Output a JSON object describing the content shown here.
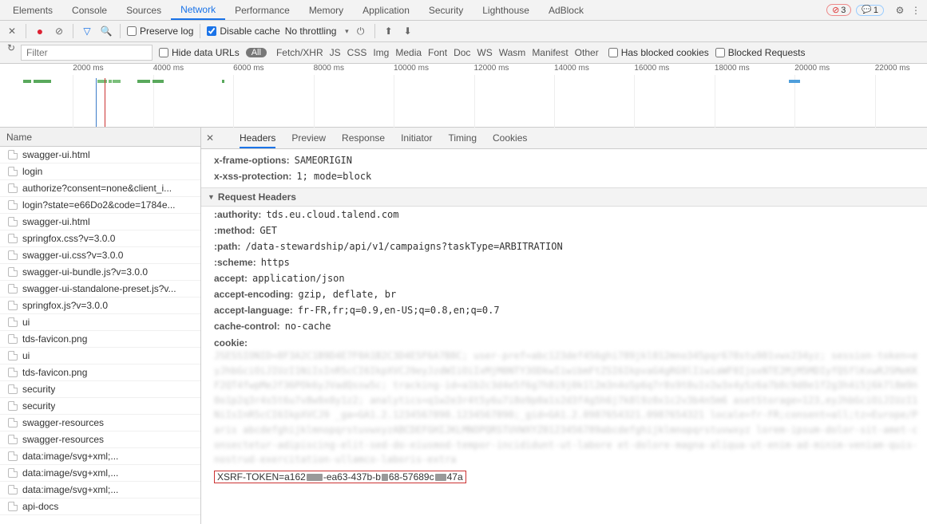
{
  "tabs": {
    "elements": "Elements",
    "console": "Console",
    "sources": "Sources",
    "network": "Network",
    "performance": "Performance",
    "memory": "Memory",
    "application": "Application",
    "security": "Security",
    "lighthouse": "Lighthouse",
    "adblock": "AdBlock"
  },
  "topbar": {
    "errors": "3",
    "messages": "1"
  },
  "toolbar": {
    "preserve_log": "Preserve log",
    "disable_cache": "Disable cache",
    "throttling": "No throttling"
  },
  "filter": {
    "placeholder": "Filter",
    "hide_data_urls": "Hide data URLs",
    "all": "All",
    "types": [
      "Fetch/XHR",
      "JS",
      "CSS",
      "Img",
      "Media",
      "Font",
      "Doc",
      "WS",
      "Wasm",
      "Manifest",
      "Other"
    ],
    "has_blocked_cookies": "Has blocked cookies",
    "blocked_requests": "Blocked Requests"
  },
  "timeline": {
    "ticks": [
      "2000 ms",
      "4000 ms",
      "6000 ms",
      "8000 ms",
      "10000 ms",
      "12000 ms",
      "14000 ms",
      "16000 ms",
      "18000 ms",
      "20000 ms",
      "22000 ms"
    ]
  },
  "name_list": {
    "header": "Name",
    "items": [
      "swagger-ui.html",
      "login",
      "authorize?consent=none&client_i...",
      "login?state=e66Do2&code=1784e...",
      "swagger-ui.html",
      "springfox.css?v=3.0.0",
      "swagger-ui.css?v=3.0.0",
      "swagger-ui-bundle.js?v=3.0.0",
      "swagger-ui-standalone-preset.js?v...",
      "springfox.js?v=3.0.0",
      "ui",
      "tds-favicon.png",
      "ui",
      "tds-favicon.png",
      "security",
      "security",
      "swagger-resources",
      "swagger-resources",
      "data:image/svg+xml;...",
      "data:image/svg+xml,...",
      "data:image/svg+xml;...",
      "api-docs"
    ]
  },
  "details": {
    "tabs": {
      "headers": "Headers",
      "preview": "Preview",
      "response": "Response",
      "initiator": "Initiator",
      "timing": "Timing",
      "cookies": "Cookies"
    },
    "resp_headers": {
      "x_frame": {
        "k": "x-frame-options:",
        "v": "SAMEORIGIN"
      },
      "x_xss": {
        "k": "x-xss-protection:",
        "v": "1; mode=block"
      }
    },
    "section_req": "Request Headers",
    "req_headers": {
      "authority": {
        "k": ":authority:",
        "v": "tds.eu.cloud.talend.com"
      },
      "method": {
        "k": ":method:",
        "v": "GET"
      },
      "path": {
        "k": ":path:",
        "v": "/data-stewardship/api/v1/campaigns?taskType=ARBITRATION"
      },
      "scheme": {
        "k": ":scheme:",
        "v": "https"
      },
      "accept": {
        "k": "accept:",
        "v": "application/json"
      },
      "accept_enc": {
        "k": "accept-encoding:",
        "v": "gzip, deflate, br"
      },
      "accept_lang": {
        "k": "accept-language:",
        "v": "fr-FR,fr;q=0.9,en-US;q=0.8,en;q=0.7"
      },
      "cache": {
        "k": "cache-control:",
        "v": "no-cache"
      },
      "cookie": {
        "k": "cookie:",
        "v": ""
      }
    },
    "token": {
      "prefix": "XSRF-TOKEN=a162",
      "mid1": "-ea63-437b-b",
      "mid2": "68-57689c",
      "suffix": "47a"
    }
  }
}
